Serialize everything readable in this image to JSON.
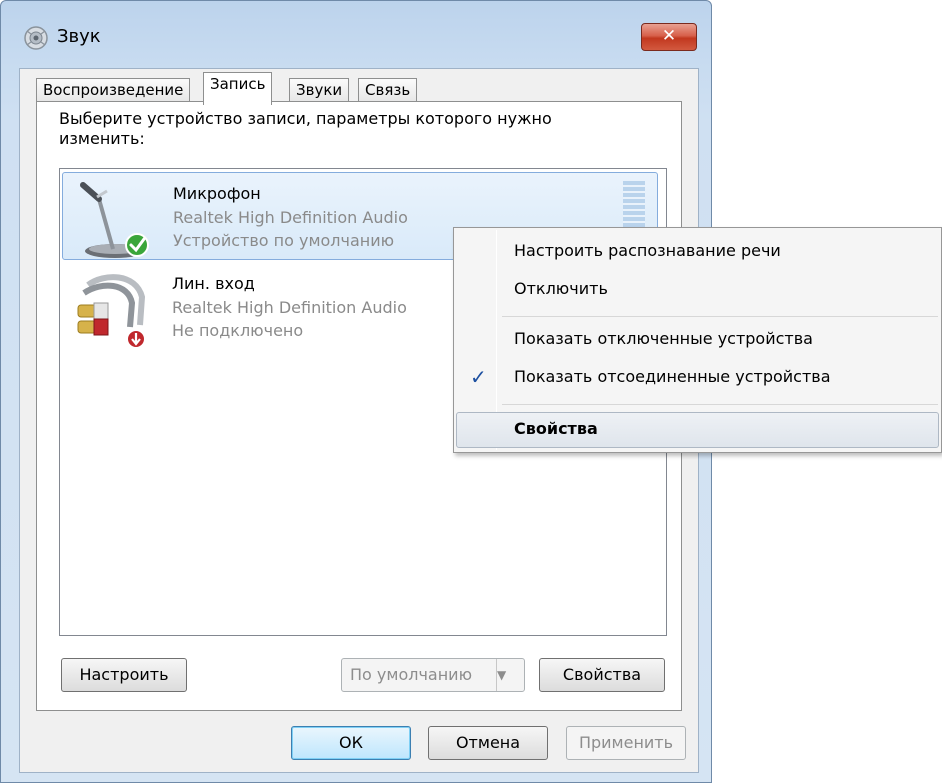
{
  "window": {
    "title": "Звук",
    "close_label": "✕"
  },
  "tabs": [
    {
      "label": "Воспроизведение"
    },
    {
      "label": "Запись"
    },
    {
      "label": "Звуки"
    },
    {
      "label": "Связь"
    }
  ],
  "active_tab": "Запись",
  "panel": {
    "prompt": "Выберите устройство записи, параметры которого нужно изменить:"
  },
  "devices": [
    {
      "name": "Микрофон",
      "driver": "Realtek High Definition Audio",
      "status": "Устройство по умолчанию",
      "icon": "microphone-icon",
      "badge": "default-check-icon",
      "selected": true
    },
    {
      "name": "Лин. вход",
      "driver": "Realtek High Definition Audio",
      "status": "Не подключено",
      "icon": "line-in-cable-icon",
      "badge": "unplugged-arrow-icon",
      "selected": false
    }
  ],
  "panel_buttons": {
    "configure": "Настроить",
    "set_default": "По умолчанию",
    "properties": "Свойства"
  },
  "dialog_buttons": {
    "ok": "ОК",
    "cancel": "Отмена",
    "apply": "Применить"
  },
  "context_menu": {
    "items": [
      {
        "label": "Настроить распознавание речи"
      },
      {
        "label": "Отключить"
      },
      {
        "label": "Показать отключенные устройства"
      },
      {
        "label": "Показать отсоединенные устройства",
        "checked": true
      },
      {
        "label": "Свойства",
        "bold": true,
        "highlighted": true
      }
    ],
    "check_mark": "✓"
  },
  "colors": {
    "selection_fill": "#d9eaf9",
    "close_red": "#c2381f",
    "check_blue": "#1c4fa0",
    "default_badge_green": "#3aa63a",
    "unplugged_badge_red": "#c0282d"
  }
}
